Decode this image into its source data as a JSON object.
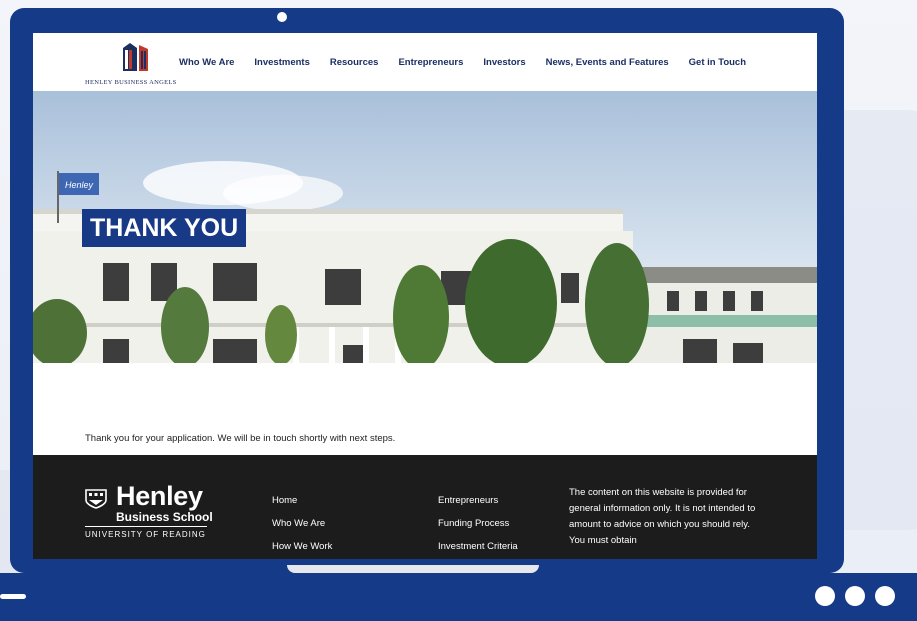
{
  "site": {
    "logo_text": "HENLEY BUSINESS ANGELS",
    "nav": [
      "Who We Are",
      "Investments",
      "Resources",
      "Entrepreneurs",
      "Investors",
      "News, Events and Features",
      "Get in Touch"
    ]
  },
  "hero": {
    "title": "THANK YOU",
    "flag_text": "Henley"
  },
  "content": {
    "message": "Thank you for your application. We will be in touch shortly with next steps."
  },
  "footer": {
    "logo_name": "Henley",
    "logo_school": "Business School",
    "logo_university": "UNIVERSITY OF READING",
    "col1": [
      "Home",
      "Who We Are",
      "How We Work"
    ],
    "col2": [
      "Entrepreneurs",
      "Funding Process",
      "Investment Criteria"
    ],
    "disclaimer": "The content on this website is provided for general information only. It is not intended to amount to advice on which you should rely. You must obtain"
  },
  "colors": {
    "frame_blue": "#153a87",
    "brand_navy": "#1c2f63",
    "footer_bg": "#1c1c1c"
  }
}
